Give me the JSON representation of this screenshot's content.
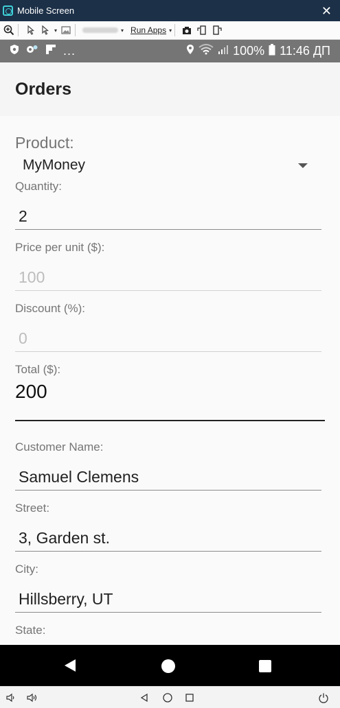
{
  "window": {
    "title": "Mobile Screen",
    "close_glyph": "✕"
  },
  "toolbar": {
    "run_apps_label": "Run Apps",
    "icons": [
      "zoom-in-icon",
      "pointer-icon",
      "pointer-dropdown-icon",
      "image-icon",
      "screenshot-icon",
      "rotate-left-icon",
      "rotate-right-icon"
    ]
  },
  "statusbar": {
    "battery": "100%",
    "time": "11:46 ДП",
    "overflow": "..."
  },
  "appbar": {
    "title": "Orders"
  },
  "form": {
    "product_label": "Product:",
    "product_value": "MyMoney",
    "quantity_label": "Quantity:",
    "quantity_value": "2",
    "price_label": "Price per unit ($):",
    "price_value": "100",
    "discount_label": "Discount (%):",
    "discount_value": "0",
    "total_label": "Total ($):",
    "total_value": "200",
    "customer_label": "Customer Name:",
    "customer_value": "Samuel Clemens",
    "street_label": "Street:",
    "street_value": "3, Garden st.",
    "city_label": "City:",
    "city_value": "Hillsberry, UT",
    "state_label": "State:"
  },
  "colors": {
    "host_titlebar": "#1c3048",
    "status_bar": "#757575",
    "app_bar": "#f5f5f5",
    "label_gray": "#757575",
    "nav_bar": "#000000"
  }
}
